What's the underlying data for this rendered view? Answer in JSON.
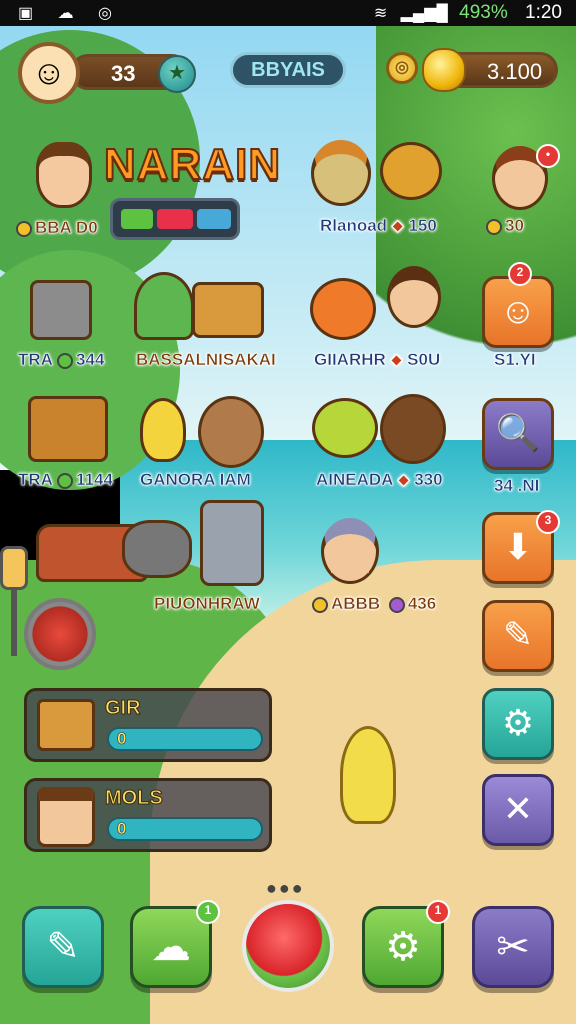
{
  "status_bar": {
    "time": "1:20",
    "battery": "493%"
  },
  "top_bar": {
    "player_level": "33",
    "center_label": "BBYAIS",
    "gold_amount": "3.100"
  },
  "title": "NARAIN",
  "left_score": "BBA D0",
  "row1": {
    "name1": "Rlanoad",
    "value1": "150",
    "right_value": "30"
  },
  "row2": {
    "left_prefix": "TRA",
    "left_value": "344",
    "center_label": "BASSALNISAKAI",
    "right_label": "GIIARHR",
    "right_value": "S0U",
    "side_value": "S1.YI"
  },
  "row3": {
    "left_prefix": "TRA",
    "left_value": "1144",
    "center_label": "GANORA IAM",
    "right_label": "AINEADA",
    "right_value": "330",
    "side_value": "34 .NI"
  },
  "row4": {
    "center_label": "PIUONHRAW",
    "right_label": "ABBB",
    "right_value": "436"
  },
  "panels": [
    {
      "title": "GIR",
      "value": "0"
    },
    {
      "title": "MOLS",
      "value": "0"
    }
  ],
  "badges": {
    "side1": "2",
    "side3": "3",
    "bottom2": "1",
    "bottom4": "1"
  },
  "colors": {
    "accent_orange": "#f28a2e",
    "panel_bg": "#4a4a54",
    "green_button": "#6cc24a",
    "teal_button": "#35b7ad",
    "purple_button": "#6a5aa8"
  }
}
